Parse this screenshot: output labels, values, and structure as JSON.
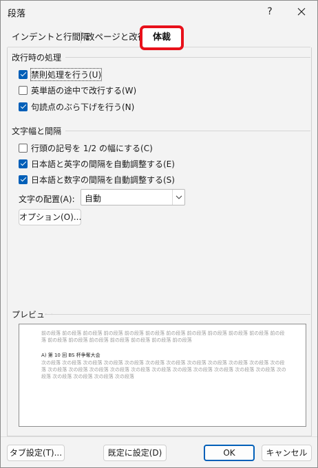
{
  "window": {
    "title": "段落",
    "help": "?"
  },
  "tabs": {
    "indent": "インデントと行間隔",
    "page": "改ページと改行",
    "layout": "体裁"
  },
  "line_break": {
    "label": "改行時の処理",
    "items": [
      {
        "label": "禁則処理を行う(U)",
        "checked": true
      },
      {
        "label": "英単語の途中で改行する(W)",
        "checked": false
      },
      {
        "label": "句読点のぶら下げを行う(N)",
        "checked": true
      }
    ]
  },
  "char_spacing": {
    "label": "文字幅と間隔",
    "items": [
      {
        "label": "行頭の記号を 1/2 の幅にする(C)",
        "checked": false
      },
      {
        "label": "日本語と英字の間隔を自動調整する(E)",
        "checked": true
      },
      {
        "label": "日本語と数字の間隔を自動調整する(S)",
        "checked": true
      }
    ],
    "align_label": "文字の配置(A):",
    "align_value": "自動",
    "options_button": "オプション(O)..."
  },
  "preview": {
    "label": "プレビュー",
    "prev_text": "前の段落 前の段落 前の段落 前の段落 前の段落 前の段落 前の段落 前の段落 前の段落 前の段落 前の段落 前の段落 前の段落 前の段落 前の段落 前の段落 前の段落 前の段落 前の段落",
    "main_text": "A) 第 10 回 BS 杯争奪大会",
    "next_text": "次の段落 次の段落 次の段落 次の段落 次の段落 次の段落 次の段落 次の段落 次の段落 次の段落 次の段落 次の段落 次の段落 次の段落 次の段落 次の段落 次の段落 次の段落 次の段落 次の段落 次の段落 次の段落 次の段落 次の段落 次の段落 次の段落 次の段落 次の段落"
  },
  "footer": {
    "tab_button": "タブ設定(T)...",
    "default_button": "既定に設定(D)",
    "ok_button": "OK",
    "cancel_button": "キャンセル"
  },
  "colors": {
    "accent": "#005fb8",
    "highlight": "#e8101a"
  }
}
